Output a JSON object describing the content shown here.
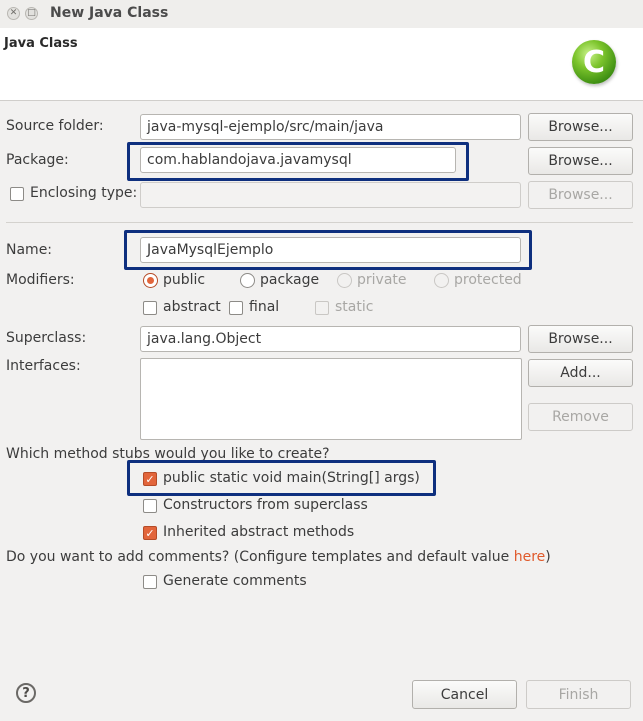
{
  "window": {
    "title": "New Java Class",
    "close_glyph": "✕",
    "minimize_glyph": "□"
  },
  "banner": {
    "title": "Java Class",
    "logo_letter": "C",
    "logo_icon": "java-class-icon"
  },
  "form": {
    "source_folder": {
      "label": "Source folder:",
      "value": "java-mysql-ejemplo/src/main/java",
      "browse_label": "Browse..."
    },
    "package": {
      "label": "Package:",
      "value": "com.hablandojava.javamysql",
      "browse_label": "Browse..."
    },
    "enclosing_type": {
      "label": "Enclosing type:",
      "value": "",
      "checked": false,
      "browse_label": "Browse..."
    },
    "name": {
      "label": "Name:",
      "value": "JavaMysqlEjemplo"
    },
    "modifiers": {
      "label": "Modifiers:",
      "access": [
        "public",
        "package",
        "private",
        "protected"
      ],
      "selected": "public",
      "other": [
        {
          "label": "abstract",
          "checked": false
        },
        {
          "label": "final",
          "checked": false
        },
        {
          "label": "static",
          "checked": false,
          "disabled": true
        }
      ]
    },
    "superclass": {
      "label": "Superclass:",
      "value": "java.lang.Object",
      "browse_label": "Browse..."
    },
    "interfaces": {
      "label": "Interfaces:",
      "add_label": "Add...",
      "remove_label": "Remove",
      "items": []
    }
  },
  "stubs": {
    "question": "Which method stubs would you like to create?",
    "options": [
      {
        "label": "public static void main(String[] args)",
        "checked": true
      },
      {
        "label": "Constructors from superclass",
        "checked": false
      },
      {
        "label": "Inherited abstract methods",
        "checked": true
      }
    ]
  },
  "comments": {
    "question_prefix": "Do you want to add comments? (Configure templates and default value ",
    "link_text": "here",
    "question_suffix": ")",
    "option": {
      "label": "Generate comments",
      "checked": false
    }
  },
  "footer": {
    "help_glyph": "?",
    "cancel_label": "Cancel",
    "finish_label": "Finish"
  },
  "colors": {
    "accent": "#e2653b",
    "highlight_box": "#0e2f7e",
    "link": "#e05a2b"
  }
}
